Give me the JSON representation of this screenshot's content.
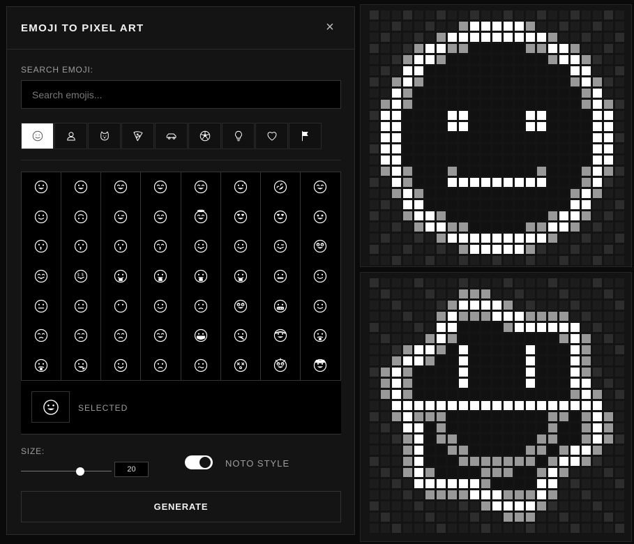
{
  "panel": {
    "title": "EMOJI TO PIXEL ART",
    "close_glyph": "×"
  },
  "search": {
    "label": "SEARCH EMOJI:",
    "placeholder": "Search emojis..."
  },
  "categories": [
    {
      "icon": "smiley-icon",
      "active": true
    },
    {
      "icon": "person-icon",
      "active": false
    },
    {
      "icon": "cat-icon",
      "active": false
    },
    {
      "icon": "pizza-icon",
      "active": false
    },
    {
      "icon": "car-icon",
      "active": false
    },
    {
      "icon": "soccer-ball-icon",
      "active": false
    },
    {
      "icon": "lightbulb-icon",
      "active": false
    },
    {
      "icon": "heart-icon",
      "active": false
    },
    {
      "icon": "flag-icon",
      "active": false
    }
  ],
  "emojis": [
    "grinning-face",
    "grinning-face-big-eyes",
    "grinning-face-smiling-eyes",
    "beaming-face",
    "grinning-squinting-face",
    "grinning-face-sweat",
    "rolling-on-floor-laughing",
    "face-tears-of-joy",
    "slightly-smiling-face",
    "upside-down-face",
    "winking-face",
    "smiling-face-smiling-eyes",
    "smiling-face-halo",
    "smiling-face-hearts",
    "heart-eyes",
    "star-struck",
    "face-blowing-kiss",
    "kissing-face",
    "kissing-face-closed-eyes",
    "kissing-face-smiling-eyes",
    "face-savoring-food",
    "face-tongue",
    "winking-face-tongue",
    "zany-face",
    "squinting-face-tongue",
    "money-mouth-face",
    "hugging-face",
    "face-hand-over-mouth",
    "shushing-face",
    "thinking-face",
    "zipper-mouth-face",
    "face-raised-eyebrow",
    "neutral-face",
    "expressionless-face",
    "face-without-mouth",
    "smirking-face",
    "unamused-face",
    "face-rolling-eyes",
    "grimacing-face",
    "lying-face",
    "relieved-face",
    "pensive-face",
    "sleepy-face",
    "sleeping-face",
    "face-medical-mask",
    "face-thermometer",
    "face-head-bandage",
    "nauseated-face",
    "face-vomiting",
    "sneezing-face",
    "hot-face",
    "cold-face",
    "woozy-face",
    "dizzy-face",
    "exploding-head",
    "cowboy-hat-face"
  ],
  "selected": {
    "label": "SELECTED",
    "emoji": "grinning-face"
  },
  "size": {
    "label": "SIZE:",
    "value": "20",
    "fraction": 0.65
  },
  "noto": {
    "label": "NOTO STYLE",
    "on": true
  },
  "generate_label": "GENERATE",
  "colors": {
    "accent": "#ffffff",
    "panel": "#141414",
    "border": "#2c2c2c"
  }
}
